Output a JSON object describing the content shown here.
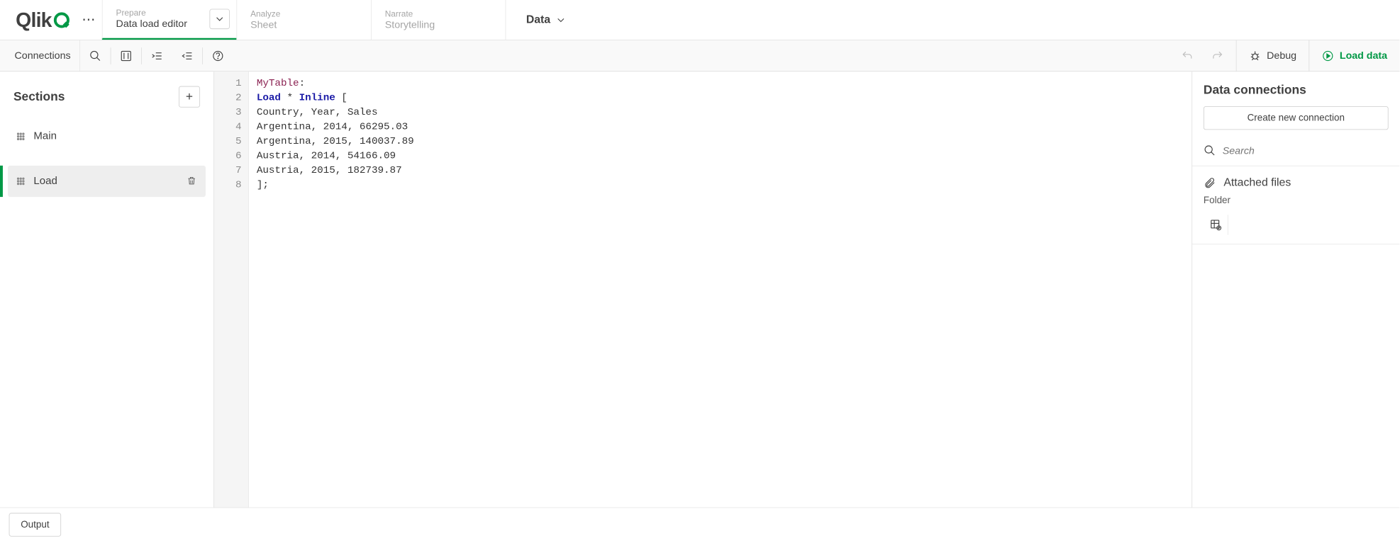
{
  "logo_text": "Qlik",
  "nav": {
    "tabs": [
      {
        "top": "Prepare",
        "bottom": "Data load editor"
      },
      {
        "top": "Analyze",
        "bottom": "Sheet"
      },
      {
        "top": "Narrate",
        "bottom": "Storytelling"
      }
    ],
    "data_label": "Data"
  },
  "toolbar": {
    "connections": "Connections",
    "debug": "Debug",
    "load": "Load data"
  },
  "sections": {
    "title": "Sections",
    "items": [
      {
        "name": "Main"
      },
      {
        "name": "Load"
      }
    ]
  },
  "editor": {
    "lines": [
      {
        "n": 1,
        "raw": "MyTable:",
        "tokens": [
          {
            "t": "label",
            "v": "MyTable"
          },
          {
            "t": "plain",
            "v": ":"
          }
        ]
      },
      {
        "n": 2,
        "raw": "Load * Inline [",
        "tokens": [
          {
            "t": "keyword",
            "v": "Load"
          },
          {
            "t": "plain",
            "v": " * "
          },
          {
            "t": "keyword",
            "v": "Inline"
          },
          {
            "t": "plain",
            "v": " ["
          }
        ]
      },
      {
        "n": 3,
        "raw": "Country, Year, Sales",
        "tokens": [
          {
            "t": "plain",
            "v": "Country, Year, Sales"
          }
        ]
      },
      {
        "n": 4,
        "raw": "Argentina, 2014, 66295.03",
        "tokens": [
          {
            "t": "plain",
            "v": "Argentina, 2014, 66295.03"
          }
        ]
      },
      {
        "n": 5,
        "raw": "Argentina, 2015, 140037.89",
        "tokens": [
          {
            "t": "plain",
            "v": "Argentina, 2015, 140037.89"
          }
        ]
      },
      {
        "n": 6,
        "raw": "Austria, 2014, 54166.09",
        "tokens": [
          {
            "t": "plain",
            "v": "Austria, 2014, 54166.09"
          }
        ]
      },
      {
        "n": 7,
        "raw": "Austria, 2015, 182739.87",
        "tokens": [
          {
            "t": "plain",
            "v": "Austria, 2015, 182739.87"
          }
        ]
      },
      {
        "n": 8,
        "raw": "];",
        "tokens": [
          {
            "t": "plain",
            "v": "];"
          }
        ]
      }
    ]
  },
  "connections": {
    "title": "Data connections",
    "create": "Create new connection",
    "search_placeholder": "Search",
    "attached": "Attached files",
    "folder": "Folder"
  },
  "footer": {
    "output": "Output"
  }
}
